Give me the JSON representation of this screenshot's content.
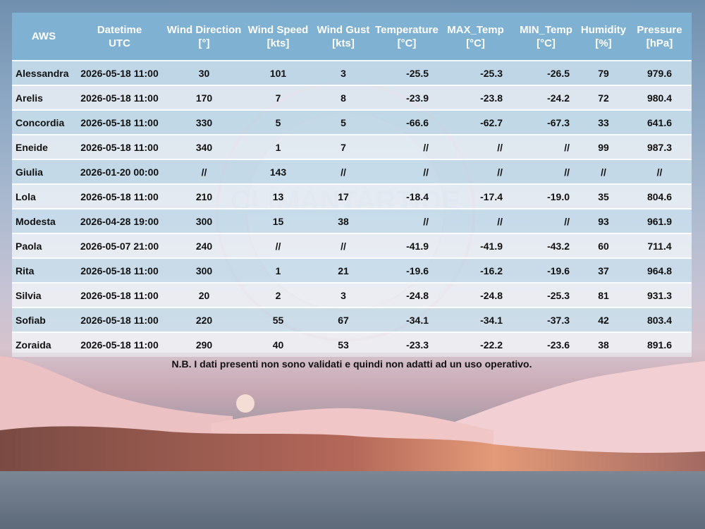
{
  "columns": [
    {
      "line1": "AWS",
      "line2": ""
    },
    {
      "line1": "Datetime",
      "line2": "UTC"
    },
    {
      "line1": "Wind Direction",
      "line2": "[°]"
    },
    {
      "line1": "Wind Speed",
      "line2": "[kts]"
    },
    {
      "line1": "Wind Gust",
      "line2": "[kts]"
    },
    {
      "line1": "Temperature",
      "line2": "[°C]"
    },
    {
      "line1": "MAX_Temp",
      "line2": "[°C]"
    },
    {
      "line1": "MIN_Temp",
      "line2": "[°C]"
    },
    {
      "line1": "Humidity",
      "line2": "[%]"
    },
    {
      "line1": "Pressure",
      "line2": "[hPa]"
    }
  ],
  "rows": [
    [
      "Alessandra",
      "2026-05-18 11:00",
      "30",
      "101",
      "3",
      "-25.5",
      "-25.3",
      "-26.5",
      "79",
      "979.6"
    ],
    [
      "Arelis",
      "2026-05-18 11:00",
      "170",
      "7",
      "8",
      "-23.9",
      "-23.8",
      "-24.2",
      "72",
      "980.4"
    ],
    [
      "Concordia",
      "2026-05-18 11:00",
      "330",
      "5",
      "5",
      "-66.6",
      "-62.7",
      "-67.3",
      "33",
      "641.6"
    ],
    [
      "Eneide",
      "2026-05-18 11:00",
      "340",
      "1",
      "7",
      "//",
      "//",
      "//",
      "99",
      "987.3"
    ],
    [
      "Giulia",
      "2026-01-20 00:00",
      "//",
      "143",
      "//",
      "//",
      "//",
      "//",
      "//",
      "//"
    ],
    [
      "Lola",
      "2026-05-18 11:00",
      "210",
      "13",
      "17",
      "-18.4",
      "-17.4",
      "-19.0",
      "35",
      "804.6"
    ],
    [
      "Modesta",
      "2026-04-28 19:00",
      "300",
      "15",
      "38",
      "//",
      "//",
      "//",
      "93",
      "961.9"
    ],
    [
      "Paola",
      "2026-05-07 21:00",
      "240",
      "//",
      "//",
      "-41.9",
      "-41.9",
      "-43.2",
      "60",
      "711.4"
    ],
    [
      "Rita",
      "2026-05-18 11:00",
      "300",
      "1",
      "21",
      "-19.6",
      "-16.2",
      "-19.6",
      "37",
      "964.8"
    ],
    [
      "Silvia",
      "2026-05-18 11:00",
      "20",
      "2",
      "3",
      "-24.8",
      "-24.8",
      "-25.3",
      "81",
      "931.3"
    ],
    [
      "Sofiab",
      "2026-05-18 11:00",
      "220",
      "55",
      "67",
      "-34.1",
      "-34.1",
      "-37.3",
      "42",
      "803.4"
    ],
    [
      "Zoraida",
      "2026-05-18 11:00",
      "290",
      "40",
      "53",
      "-23.3",
      "-22.2",
      "-23.6",
      "38",
      "891.6"
    ]
  ],
  "watermark_text": "OSSERVATORIO METEO-CLIMATOLOGICO ANTARTICO · CLIMANTARTIDE · ITALIA",
  "note": "N.B. I dati presenti non sono validati e quindi non adatti ad un uso operativo.",
  "colors": {
    "header_bg": "#7fb1d3",
    "header_text": "#ffffff",
    "row_odd": "#b9d7e9",
    "row_even": "#ecf3f8"
  }
}
